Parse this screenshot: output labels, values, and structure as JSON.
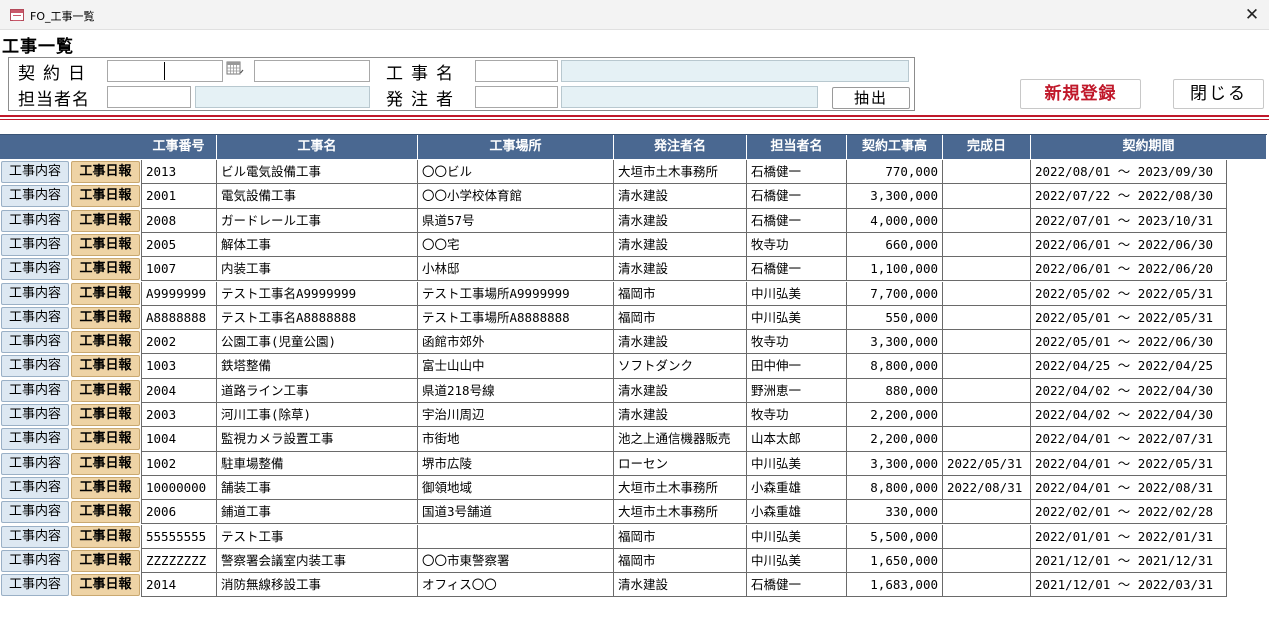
{
  "window": {
    "title": "FO_工事一覧",
    "close_glyph": "✕"
  },
  "form": {
    "title": "工事一覧"
  },
  "filter": {
    "contract_date_label": "契約日",
    "manager_label": "担当者名",
    "project_name_label": "工事名",
    "client_label": "発注者",
    "contract_date_from": "",
    "contract_date_to": "",
    "manager_code": "",
    "manager_name": "",
    "project_name_code": "",
    "project_name_value": "",
    "client_code": "",
    "client_name": "",
    "extract_button": "抽出"
  },
  "actions": {
    "new_button": "新規登録",
    "close_button": "閉じる"
  },
  "table": {
    "columns": [
      "工事番号",
      "工事名",
      "工事場所",
      "発注者名",
      "担当者名",
      "契約工事高",
      "完成日",
      "契約期間"
    ],
    "row_button_detail": "工事内容",
    "row_button_daily": "工事日報",
    "rows": [
      [
        "2013",
        "ビル電気設備工事",
        "〇〇ビル",
        "大垣市土木事務所",
        "石橋健一",
        "770,000",
        "",
        "2022/08/01 ～ 2023/09/30"
      ],
      [
        "2001",
        "電気設備工事",
        "〇〇小学校体育館",
        "清水建設",
        "石橋健一",
        "3,300,000",
        "",
        "2022/07/22 ～ 2022/08/30"
      ],
      [
        "2008",
        "ガードレール工事",
        "県道57号",
        "清水建設",
        "石橋健一",
        "4,000,000",
        "",
        "2022/07/01 ～ 2023/10/31"
      ],
      [
        "2005",
        "解体工事",
        "〇〇宅",
        "清水建設",
        "牧寺功",
        "660,000",
        "",
        "2022/06/01 ～ 2022/06/30"
      ],
      [
        "1007",
        "内装工事",
        "小林邸",
        "清水建設",
        "石橋健一",
        "1,100,000",
        "",
        "2022/06/01 ～ 2022/06/20"
      ],
      [
        "A9999999",
        "テスト工事名A9999999",
        "テスト工事場所A9999999",
        "福岡市",
        "中川弘美",
        "7,700,000",
        "",
        "2022/05/02 ～ 2022/05/31"
      ],
      [
        "A8888888",
        "テスト工事名A8888888",
        "テスト工事場所A8888888",
        "福岡市",
        "中川弘美",
        "550,000",
        "",
        "2022/05/01 ～ 2022/05/31"
      ],
      [
        "2002",
        "公園工事(児童公園)",
        "函館市郊外",
        "清水建設",
        "牧寺功",
        "3,300,000",
        "",
        "2022/05/01 ～ 2022/06/30"
      ],
      [
        "1003",
        "鉄塔整備",
        "富士山山中",
        "ソフトダンク",
        "田中伸一",
        "8,800,000",
        "",
        "2022/04/25 ～ 2022/04/25"
      ],
      [
        "2004",
        "道路ライン工事",
        "県道218号線",
        "清水建設",
        "野洲恵一",
        "880,000",
        "",
        "2022/04/02 ～ 2022/04/30"
      ],
      [
        "2003",
        "河川工事(除草)",
        "宇治川周辺",
        "清水建設",
        "牧寺功",
        "2,200,000",
        "",
        "2022/04/02 ～ 2022/04/30"
      ],
      [
        "1004",
        "監視カメラ設置工事",
        "市街地",
        "池之上通信機器販売",
        "山本太郎",
        "2,200,000",
        "",
        "2022/04/01 ～ 2022/07/31"
      ],
      [
        "1002",
        "駐車場整備",
        "堺市広陵",
        "ローセン",
        "中川弘美",
        "3,300,000",
        "2022/05/31",
        "2022/04/01 ～ 2022/05/31"
      ],
      [
        "10000000",
        "舗装工事",
        "御領地域",
        "大垣市土木事務所",
        "小森重雄",
        "8,800,000",
        "2022/08/31",
        "2022/04/01 ～ 2022/08/31"
      ],
      [
        "2006",
        "鋪道工事",
        "国道3号舗道",
        "大垣市土木事務所",
        "小森重雄",
        "330,000",
        "",
        "2022/02/01 ～ 2022/02/28"
      ],
      [
        "55555555",
        "テスト工事",
        "",
        "福岡市",
        "中川弘美",
        "5,500,000",
        "",
        "2022/01/01 ～ 2022/01/31"
      ],
      [
        "ZZZZZZZZ",
        "警察署会議室内装工事",
        "〇〇市東警察署",
        "福岡市",
        "中川弘美",
        "1,650,000",
        "",
        "2021/12/01 ～ 2021/12/31"
      ],
      [
        "2014",
        "消防無線移設工事",
        "オフィス〇〇",
        "清水建設",
        "石橋健一",
        "1,683,000",
        "",
        "2021/12/01 ～ 2022/03/31"
      ]
    ]
  }
}
